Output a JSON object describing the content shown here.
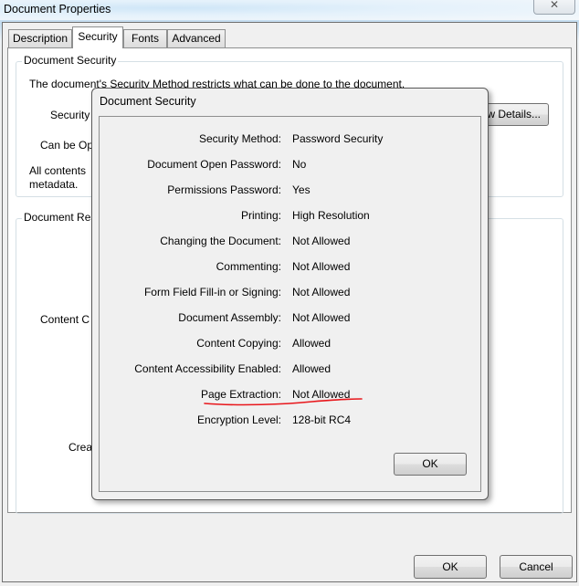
{
  "window": {
    "title": "Document Properties",
    "close_icon": "close-x-icon",
    "close_glyph": "✕"
  },
  "tabs": [
    {
      "label": "Description",
      "active": false
    },
    {
      "label": "Security",
      "active": true
    },
    {
      "label": "Fonts",
      "active": false
    },
    {
      "label": "Advanced",
      "active": false
    }
  ],
  "security_tab": {
    "group1_title": "Document Security",
    "intro_text": "The document's Security Method restricts what can be done to the document.",
    "security_method_label_partial": "Security",
    "can_be_opened_label_partial": "Can be Op",
    "all_contents_partial": "All contents",
    "metadata_text": "metadata.",
    "show_details_button_partial": "w Details...",
    "group2_title_partial": "Document Res",
    "content_copying_label_partial": "Content C",
    "creation_label_partial": "Crea"
  },
  "modal": {
    "title": "Document Security",
    "rows": [
      {
        "label": "Security Method:",
        "value": "Password Security"
      },
      {
        "label": "Document Open Password:",
        "value": "No"
      },
      {
        "label": "Permissions Password:",
        "value": "Yes"
      },
      {
        "label": "Printing:",
        "value": "High Resolution"
      },
      {
        "label": "Changing the Document:",
        "value": "Not Allowed"
      },
      {
        "label": "Commenting:",
        "value": "Not Allowed"
      },
      {
        "label": "Form Field Fill-in or Signing:",
        "value": "Not Allowed"
      },
      {
        "label": "Document Assembly:",
        "value": "Not Allowed"
      },
      {
        "label": "Content Copying:",
        "value": "Allowed"
      },
      {
        "label": "Content Accessibility Enabled:",
        "value": "Allowed"
      },
      {
        "label": "Page Extraction:",
        "value": "Not Allowed"
      },
      {
        "label": "Encryption Level:",
        "value": "128-bit RC4"
      }
    ],
    "ok_label": "OK",
    "annotation_color": "#e8161b"
  },
  "footer": {
    "ok_label": "OK",
    "cancel_label": "Cancel"
  }
}
